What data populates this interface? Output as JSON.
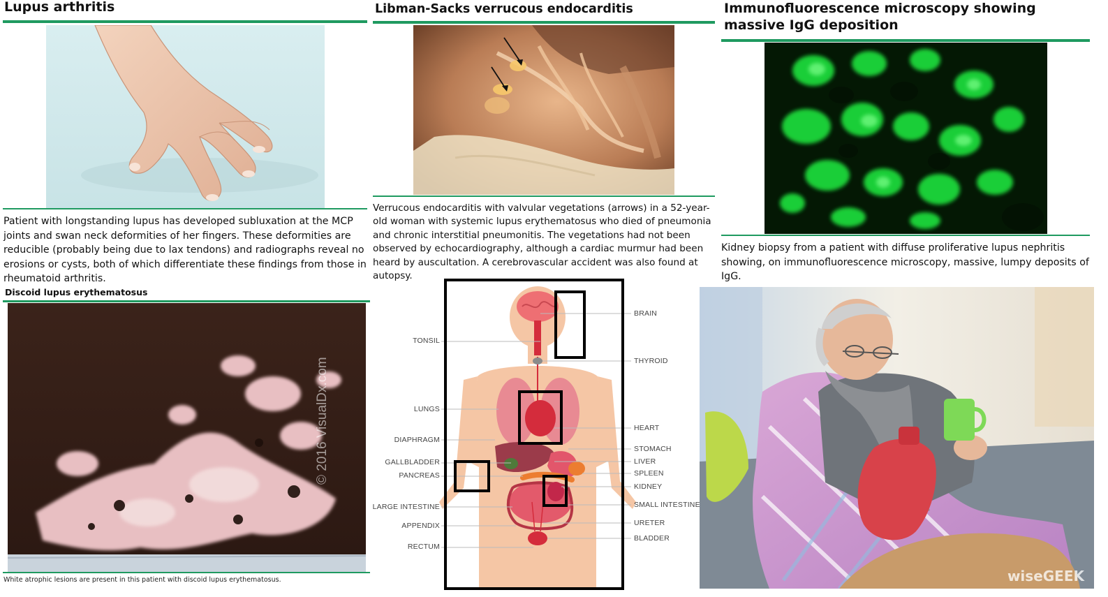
{
  "panels": {
    "lupus_arthritis": {
      "title": "Lupus arthritis",
      "caption": "Patient with longstanding lupus has developed subluxation at the MCP joints and swan neck deformities of her fingers. These deformities are reducible (probably being due to lax tendons) and radiographs reveal no erosions or cysts, both of which differentiate these findings from those in rheumatoid arthritis."
    },
    "libman_sacks": {
      "title": "Libman-Sacks verrucous endocarditis",
      "caption": "Verrucous endocarditis with valvular vegetations (arrows) in a 52-year-old woman with systemic lupus erythematosus who died of pneumonia and chronic interstitial pneumonitis. The vegetations had not been observed by echocardiography, although a cardiac murmur had been heard by auscultation. A cerebrovascular accident was also found at autopsy."
    },
    "immunofluorescence": {
      "title": "Immunofluorescence microscopy showing massive IgG deposition",
      "caption": "Kidney biopsy from a patient with diffuse proliferative lupus nephritis showing, on immunofluorescence microscopy, massive, lumpy deposits of IgG."
    },
    "discoid": {
      "title": "Discoid lupus erythematosus",
      "caption": "White atrophic lesions are present in this patient with discoid lupus erythematosus.",
      "watermark": "© 2016 VisualDx.com"
    },
    "anatomy": {
      "labels_left": [
        "TONSIL",
        "LUNGS",
        "DIAPHRAGM",
        "GALLBLADDER",
        "PANCREAS",
        "LARGE INTESTINE",
        "APPENDIX",
        "RECTUM"
      ],
      "labels_right": [
        "BRAIN",
        "THYROID",
        "HEART",
        "STOMACH",
        "LIVER",
        "SPLEEN",
        "KIDNEY",
        "SMALL INTESTINE",
        "URETER",
        "BLADDER"
      ]
    },
    "sick_man": {
      "watermark": "wiseGEEK"
    }
  },
  "colors": {
    "accent_green": "#1f9a60",
    "fluorescence": "#22e83c",
    "box_outline": "#000000"
  }
}
